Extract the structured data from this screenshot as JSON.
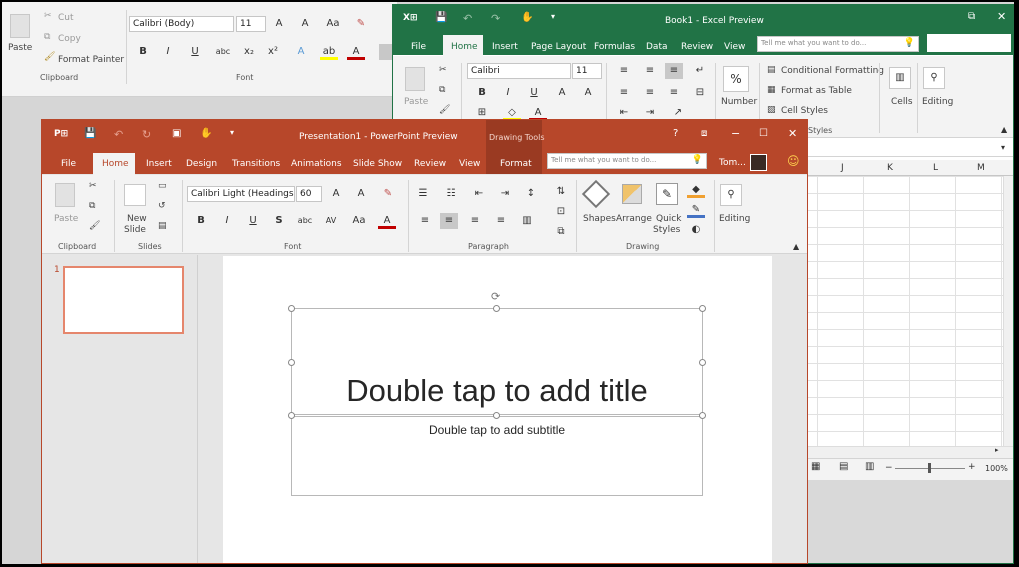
{
  "word": {
    "clipboard": {
      "paste": "Paste",
      "cut": "Cut",
      "copy": "Copy",
      "format_painter": "Format Painter",
      "group": "Clipboard"
    },
    "font": {
      "name": "Calibri (Body)",
      "size": "11",
      "group": "Font"
    }
  },
  "excel": {
    "title": "Book1 - Excel Preview",
    "tabs": [
      "File",
      "Home",
      "Insert",
      "Page Layout",
      "Formulas",
      "Data",
      "Review",
      "View"
    ],
    "tell_me": "Tell me what you want to do...",
    "font": {
      "name": "Calibri",
      "size": "11"
    },
    "labels": {
      "paste": "Paste",
      "number": "Number",
      "conditional": "Conditional Formatting",
      "format_table": "Format as Table",
      "cell_styles": "Cell Styles",
      "styles_group": "Styles",
      "cells": "Cells",
      "editing": "Editing"
    },
    "columns": [
      "J",
      "K",
      "L",
      "M"
    ],
    "zoom": "100%"
  },
  "ppt": {
    "title": "Presentation1 - PowerPoint Preview",
    "context": "Drawing Tools",
    "tabs": [
      "File",
      "Home",
      "Insert",
      "Design",
      "Transitions",
      "Animations",
      "Slide Show",
      "Review",
      "View",
      "Format"
    ],
    "tell_me": "Tell me what you want to do...",
    "user": "Tom...",
    "font": {
      "name": "Calibri Light (Headings)",
      "size": "60"
    },
    "labels": {
      "paste": "Paste",
      "new_slide_1": "New",
      "new_slide_2": "Slide",
      "shapes": "Shapes",
      "arrange": "Arrange",
      "quick_styles_1": "Quick",
      "quick_styles_2": "Styles",
      "editing": "Editing"
    },
    "groups": {
      "clipboard": "Clipboard",
      "slides": "Slides",
      "font": "Font",
      "paragraph": "Paragraph",
      "drawing": "Drawing"
    },
    "slide_number": "1",
    "title_placeholder": "Double tap to add title",
    "subtitle_placeholder": "Double tap to add subtitle"
  },
  "colors": {
    "excel_green": "#217346",
    "ppt_orange": "#b7472a",
    "ppt_format_tab": "#9a3a22"
  }
}
